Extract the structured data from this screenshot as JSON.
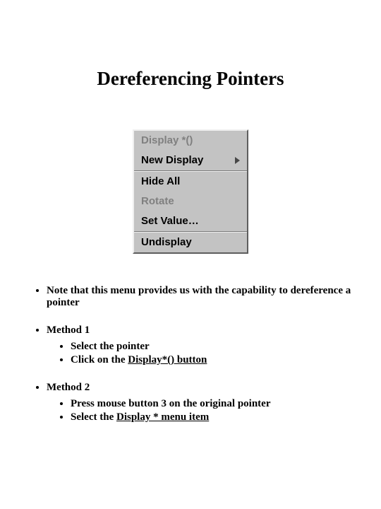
{
  "title": "Dereferencing Pointers",
  "menu": {
    "display_star_fn": "Display *()",
    "new_display": "New Display",
    "hide_all": "Hide All",
    "rotate": "Rotate",
    "set_value": "Set Value…",
    "undisplay": "Undisplay"
  },
  "notes": {
    "b1": "Note that this menu provides us with the capability to dereference a pointer",
    "b2": {
      "lead": "Method 1",
      "s1": "Select the pointer",
      "s2_prefix": "Click on the ",
      "s2_action": "Display*() button"
    },
    "b3": {
      "lead": "Method 2",
      "s1": "Press mouse button 3 on the original pointer",
      "s2_prefix": "Select the ",
      "s2_action": "Display * menu item"
    }
  }
}
